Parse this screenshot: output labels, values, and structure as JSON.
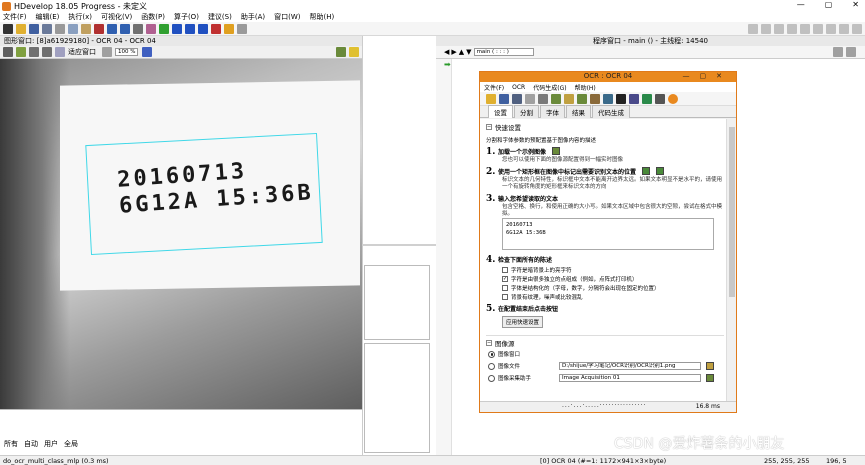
{
  "window": {
    "title": "HDevelop 18.05 Progress - 未定义",
    "controls": [
      "—",
      "▢",
      "✕"
    ]
  },
  "menu": [
    "文件(F)",
    "编辑(E)",
    "执行(x)",
    "可视化(V)",
    "函数(P)",
    "算子(O)",
    "建议(S)",
    "助手(A)",
    "窗口(W)",
    "帮助(H)"
  ],
  "graphics_window": {
    "title": "图形窗口: [8]a61929180] - OCR 04 - OCR 04",
    "mode_label": "适应窗口",
    "zoom": "100 %",
    "image_text_line1": "20160713",
    "image_text_line2": "6G12A 15:36B"
  },
  "lower_tabs": [
    "所有",
    "自动",
    "用户",
    "全局"
  ],
  "program_window": {
    "title": "程序窗口 - main () - 主线程: 14540",
    "procedure": "main ( : : : )"
  },
  "ocr_dialog": {
    "title": "OCR : OCR 04",
    "menu": [
      "文件(F)",
      "OCR",
      "代码生成(G)",
      "帮助(H)"
    ],
    "tabs": [
      "设置",
      "分割",
      "字体",
      "结果",
      "代码生成"
    ],
    "active_tab": "设置",
    "section_quick": "快速设置",
    "intro": "分割和字体参数的预配置基于图像内容的描述",
    "steps": [
      {
        "num": "1.",
        "title": "加载一个示例图像",
        "desc": "您也可以使用下面的图像源配置得到一幅实时图像"
      },
      {
        "num": "2.",
        "title": "使用一个矩形框在图像中标记出需要识别文本的位置",
        "desc": "标识文本的几何特性，标识框中文本不能离开边界太远。如果文本明显不是水平的，请使用一个有旋转角度的矩形框来标识文本的方向"
      },
      {
        "num": "3.",
        "title": "输入您希望读取的文本",
        "desc": "包含空格、换行，和使用正确的大小写。如果文本区域中包含很大的空隙，尝试在格式中模拟。"
      },
      {
        "num": "4.",
        "title": "检查下面所有的陈述",
        "desc": ""
      },
      {
        "num": "5.",
        "title": "在配置结束后点击按钮",
        "desc": ""
      }
    ],
    "text_input": [
      "20160713",
      "6G12A 15:36B"
    ],
    "checks": [
      {
        "label": "字符是暗背景上的亮字符",
        "checked": false
      },
      {
        "label": "字符是由很多独立的点组成（例如，点阵式打印机）",
        "checked": true
      },
      {
        "label": "字体是结构化的（字母，数字，分隔符会出现在固定的位置）",
        "checked": false
      },
      {
        "label": "背景有纹理，噪声或比较混乱",
        "checked": false
      }
    ],
    "apply_button": "应用快速设置",
    "section_source": "图像源",
    "sources": [
      {
        "label": "图像窗口",
        "selected": true
      },
      {
        "label": "图像文件",
        "selected": false,
        "value": "D:/shijue/学习笔记/OCR识别/OCR识别1.png"
      },
      {
        "label": "图像采集助手",
        "selected": false,
        "value": "Image Acquisition 01"
      }
    ],
    "status_dots": "...·...·.....················",
    "status_time": "16.8 ms"
  },
  "statusbar": {
    "left": "do_ocr_multi_class_mlp (0.3 ms)",
    "mid": "[0] OCR 04 (#=1: 1172×941×3×byte)",
    "right": "255, 255, 255",
    "coords": "196, 5"
  },
  "watermark": "CSDN @爱炸薯条的小朋友",
  "colors": {
    "accent_orange": "#e9891f",
    "roi_cyan": "#40d8e8",
    "pc_green": "#2a9a2a"
  }
}
